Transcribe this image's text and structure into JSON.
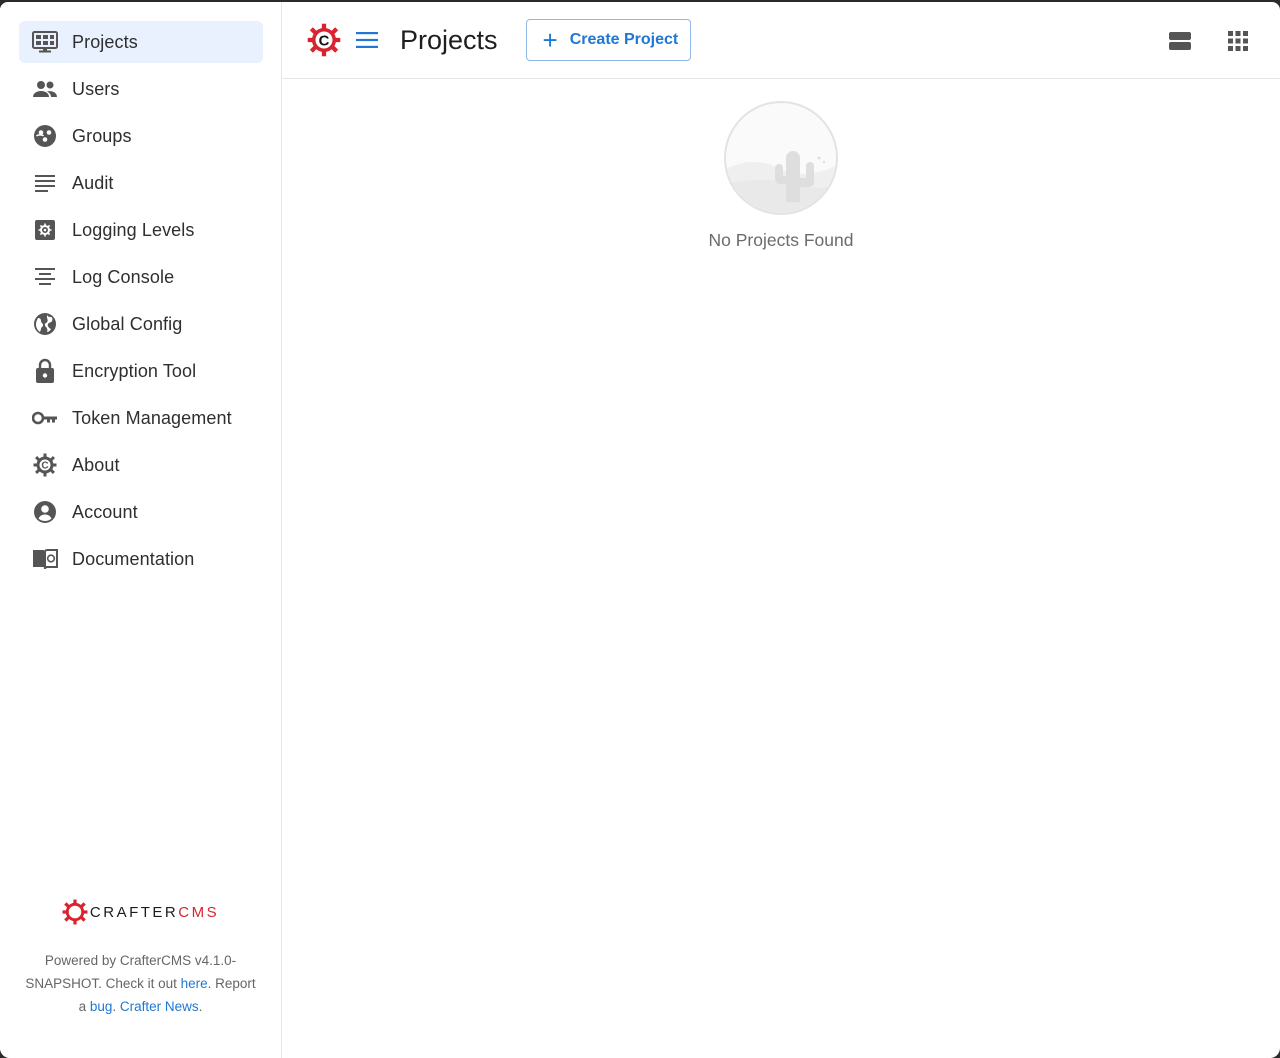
{
  "sidebar": {
    "items": [
      {
        "label": "Projects",
        "icon": "projects-icon",
        "active": true
      },
      {
        "label": "Users",
        "icon": "users-icon"
      },
      {
        "label": "Groups",
        "icon": "groups-icon"
      },
      {
        "label": "Audit",
        "icon": "audit-icon"
      },
      {
        "label": "Logging Levels",
        "icon": "logging-levels-icon"
      },
      {
        "label": "Log Console",
        "icon": "log-console-icon"
      },
      {
        "label": "Global Config",
        "icon": "globe-icon"
      },
      {
        "label": "Encryption Tool",
        "icon": "lock-icon"
      },
      {
        "label": "Token Management",
        "icon": "key-icon"
      },
      {
        "label": "About",
        "icon": "crafter-gear-icon"
      },
      {
        "label": "Account",
        "icon": "account-icon"
      },
      {
        "label": "Documentation",
        "icon": "documentation-icon"
      }
    ],
    "footer": {
      "logo_crafter": "CRAFTER",
      "logo_cms": "CMS",
      "powered_prefix": "Powered by CrafterCMS v4.1.0-SNAPSHOT. Check it out ",
      "here_link": "here",
      "report_prefix": ". Report a ",
      "bug_link": "bug",
      "sep": ". ",
      "news_link": "Crafter News",
      "end": "."
    }
  },
  "header": {
    "title": "Projects",
    "create_label": "Create Project"
  },
  "main": {
    "empty_text": "No Projects Found"
  },
  "colors": {
    "accent": "#1f78d1",
    "brand_red": "#d9232e",
    "active_bg": "#e8f1fd",
    "icon": "#555555"
  }
}
